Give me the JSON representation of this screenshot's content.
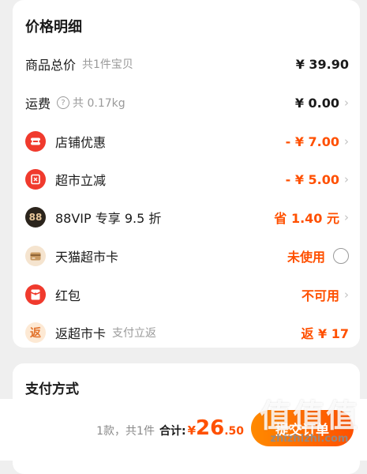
{
  "price_detail": {
    "title": "价格明细",
    "rows": [
      {
        "label": "商品总价",
        "sublabel": "共1件宝贝",
        "value": "¥ 39.90"
      },
      {
        "label": "运费",
        "help": "?",
        "sublabel": "共 0.17kg",
        "value": "¥ 0.00",
        "chevron": "›"
      },
      {
        "label": "店铺优惠",
        "value": "- ¥ 7.00",
        "chevron": "›"
      },
      {
        "label": "超市立减",
        "value": "- ¥ 5.00",
        "chevron": "›"
      },
      {
        "label": "88VIP 专享 9.5 折",
        "icon_text": "88",
        "value": "省 1.40 元",
        "chevron": "›"
      },
      {
        "label": "天猫超市卡",
        "value": "未使用"
      },
      {
        "label": "红包",
        "value": "不可用",
        "chevron": "›"
      },
      {
        "label": "返超市卡",
        "icon_text": "返",
        "sublabel": "支付立返",
        "value": "返 ¥ 17"
      }
    ]
  },
  "payment": {
    "title": "支付方式"
  },
  "bottom_bar": {
    "count_text": "1款，共1件",
    "total_label": "合计:",
    "currency": "¥",
    "total_int": "26",
    "total_dec": ".50",
    "submit_label": "提交订单"
  },
  "watermark": {
    "big": "值值值",
    "small": "zhizhizhi.com"
  },
  "colors": {
    "accent": "#ff5000",
    "icon_red": "#f03a2d",
    "icon_dark": "#2b241c"
  }
}
